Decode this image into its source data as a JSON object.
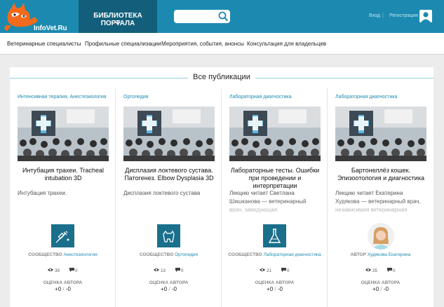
{
  "header": {
    "logo_text": "InfoVet.Ru",
    "library_tab": "БИБЛИОТЕКА ПОРТАЛА",
    "search_placeholder": "",
    "login": "Вход",
    "separator": "|",
    "register": "Регистрация"
  },
  "nav": {
    "items": [
      "Ветеринарные специалисты",
      "Профильные специализации",
      "Мероприятия, события, анонсы",
      "Консультация для владельцев"
    ]
  },
  "section": {
    "title": "Все публикации"
  },
  "cards": [
    {
      "category": "Интенсивная терапия, Анестезиология",
      "title": "Интубация трахеи. Tracheal intubation 3D",
      "description": "Интубация трахеи.",
      "owner_label": "СООБЩЕСТВО",
      "owner_value": "Анестезиология",
      "owner_icon": "syringe-icon",
      "views": "39",
      "comments": "0",
      "rating_label": "ОЦЕНКА АВТОРА",
      "rating_plus": "+0",
      "rating_sep": "/",
      "rating_minus": "-0"
    },
    {
      "category": "Ортопедия",
      "title": "Дисплазия локтевого сустава. Патогенез. Elbow Dysplasia 3D",
      "description": "Дисплазия локтевого сустава",
      "owner_label": "СООБЩЕСТВО",
      "owner_value": "Ортопедия",
      "owner_icon": "dog-icon",
      "views": "13",
      "comments": "0",
      "rating_label": "ОЦЕНКА АВТОРА",
      "rating_plus": "+0",
      "rating_sep": "/",
      "rating_minus": "-0"
    },
    {
      "category": "Лабораторная диагностика",
      "title": "Лабораторные тесты. Ошибки при проведении и интерпретации",
      "description": "Лекцию читает Светлана Шишканова — ветеринарный врач, заведующая",
      "owner_label": "СООБЩЕСТВО",
      "owner_value": "Лабораторная диагностика",
      "owner_icon": "flask-icon",
      "views": "21",
      "comments": "0",
      "rating_label": "ОЦЕНКА АВТОРА",
      "rating_plus": "+0",
      "rating_sep": "/",
      "rating_minus": "-0"
    },
    {
      "category": "Лабораторная диагностика",
      "title": "Бартонеллёз кошек. Эпизоотология и диагностика",
      "description": "Лекцию читает Екатерина Худякова — ветеринарный врач, независимая ветеринарная лаборатория",
      "owner_label": "АВТОР",
      "owner_value": "Худякова Екатерина",
      "owner_icon": "author-photo",
      "views": "25",
      "comments": "0",
      "rating_label": "ОЦЕНКА АВТОРА",
      "rating_plus": "+0",
      "rating_sep": "/",
      "rating_minus": "-0"
    }
  ],
  "colors": {
    "header_bg": "#1c8ab0",
    "library_tab_bg": "#135f7b",
    "accent": "#1c8ab0",
    "community_icon_bg": "#1a6f8b",
    "logo_orange": "#f26a1b"
  }
}
